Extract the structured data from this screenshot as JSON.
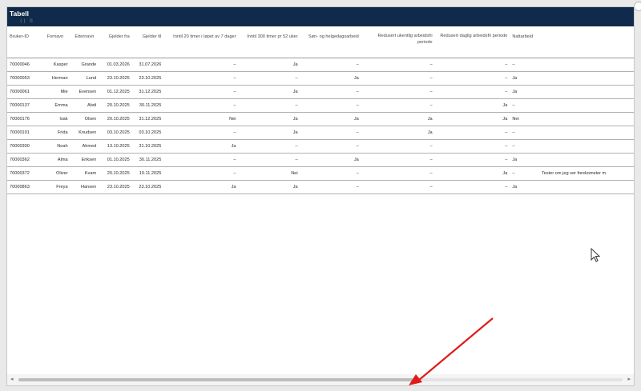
{
  "panel": {
    "title": "Tabell",
    "subicons": "⟨⟩ ⌷"
  },
  "table": {
    "columns": [
      "Bruker-ID",
      "Fornavn",
      "Etternavn",
      "Gjelder fra",
      "Gjelder til",
      "Inntil 20 timer i løpet av 7 dager",
      "Inntil 300 timer pr 52 uker",
      "Søn- og helgedagsarbeid",
      "Redusert ukentlig arbeidsfri periode",
      "Redusert daglig arbeidsfri periode",
      "Nattarbeid",
      ""
    ],
    "rows": [
      [
        "70000046",
        "Kasper",
        "Grande",
        "01.03.2026",
        "31.07.2026",
        "–",
        "Ja",
        "–",
        "–",
        "–",
        "–",
        ""
      ],
      [
        "70000053",
        "Herman",
        "Lund",
        "23.10.2025",
        "23.10.2025",
        "–",
        "–",
        "Ja",
        "–",
        "–",
        "Ja",
        ""
      ],
      [
        "70000061",
        "Mie",
        "Evensen",
        "01.12.2025",
        "31.12.2025",
        "–",
        "Ja",
        "–",
        "–",
        "–",
        "Ja",
        ""
      ],
      [
        "70000137",
        "Emma",
        "Abdi",
        "20.10.2025",
        "30.11.2025",
        "–",
        "–",
        "–",
        "–",
        "Ja",
        "–",
        ""
      ],
      [
        "70000176",
        "Isak",
        "Olsen",
        "20.10.2025",
        "31.12.2025",
        "Nei",
        "Ja",
        "Ja",
        "Ja",
        "Ja",
        "Nei",
        ""
      ],
      [
        "70000191",
        "Frida",
        "Knudsen",
        "03.10.2025",
        "03.10.2025",
        "–",
        "Ja",
        "–",
        "Ja",
        "–",
        "–",
        ""
      ],
      [
        "70000300",
        "Noah",
        "Ahmed",
        "13.10.2025",
        "31.10.2025",
        "Ja",
        "–",
        "–",
        "–",
        "–",
        "–",
        ""
      ],
      [
        "70000362",
        "Alma",
        "Eriksen",
        "01.10.2025",
        "30.11.2025",
        "–",
        "–",
        "Ja",
        "–",
        "–",
        "Ja",
        ""
      ],
      [
        "70000372",
        "Oliver",
        "Kvam",
        "20.10.2025",
        "10.11.2025",
        "–",
        "Nei",
        "–",
        "–",
        "Ja",
        "–",
        "Tester om jeg ser forekomster m"
      ],
      [
        "70000863",
        "Freya",
        "Hansen",
        "23.10.2025",
        "23.10.2025",
        "Ja",
        "Ja",
        "–",
        "–",
        "–",
        "Ja",
        ""
      ]
    ]
  },
  "scroll": {
    "left_arrow": "◂",
    "right_arrow": "▸",
    "position_fraction": 0.66
  },
  "colors": {
    "header_bg": "#0f2a4a",
    "annotation_arrow": "#e11b1b"
  }
}
